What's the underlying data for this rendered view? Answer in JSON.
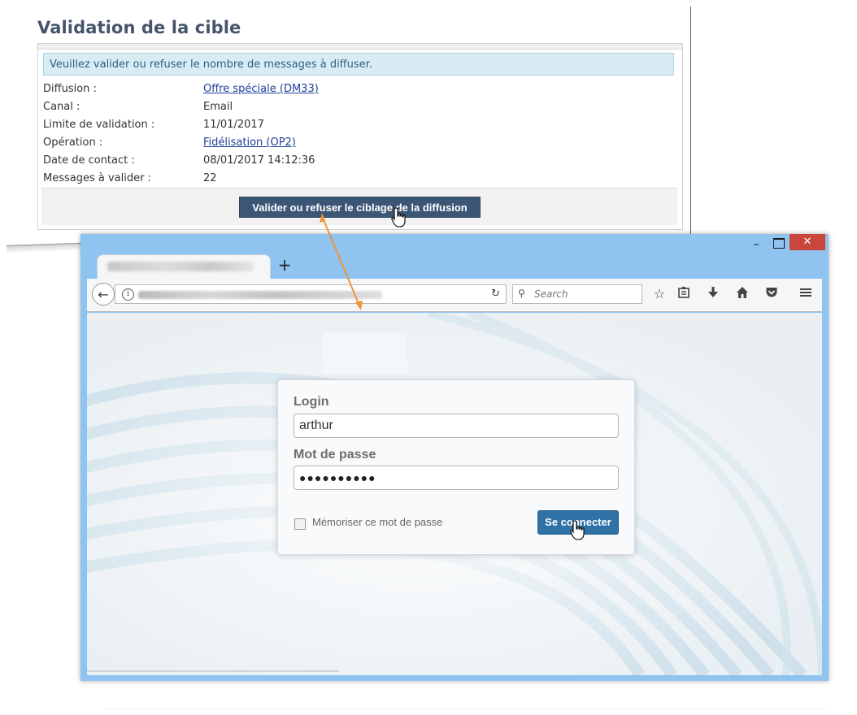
{
  "validation": {
    "title": "Validation de la cible",
    "banner": "Veuillez valider ou refuser le nombre de messages à diffuser.",
    "fields": [
      {
        "label": "Diffusion :",
        "value": "Offre spéciale (DM33)",
        "link": true
      },
      {
        "label": "Canal :",
        "value": "Email",
        "link": false
      },
      {
        "label": "Limite de validation :",
        "value": "11/01/2017",
        "link": false
      },
      {
        "label": "Opération :",
        "value": "Fidélisation (OP2)",
        "link": true
      },
      {
        "label": "Date de contact :",
        "value": "08/01/2017 14:12:36",
        "link": false
      },
      {
        "label": "Messages à valider :",
        "value": "22",
        "link": false
      }
    ],
    "button_label": "Valider ou refuser le ciblage de la diffusion"
  },
  "browser": {
    "window_controls": {
      "minimize": "–",
      "close": "✕"
    },
    "new_tab": "+",
    "search_placeholder": "Search",
    "icons": [
      "back-arrow-icon",
      "info-icon",
      "reload-icon",
      "search-icon",
      "star-icon",
      "reader-icon",
      "download-icon",
      "home-icon",
      "pocket-icon",
      "menu-icon"
    ]
  },
  "login": {
    "login_label": "Login",
    "login_value": "arthur",
    "password_label": "Mot de passe",
    "password_value": "●●●●●●●●●●",
    "remember_label": "Mémoriser ce mot de passe",
    "submit_label": "Se connecter"
  },
  "colors": {
    "heading": "#44546a",
    "banner_bg": "#d9ecf4",
    "validate_button": "#3c5676",
    "browser_frame": "#8fc3f0",
    "close_button": "#c9463d",
    "connect_button": "#2e72a7",
    "arrow": "#f0943a"
  }
}
